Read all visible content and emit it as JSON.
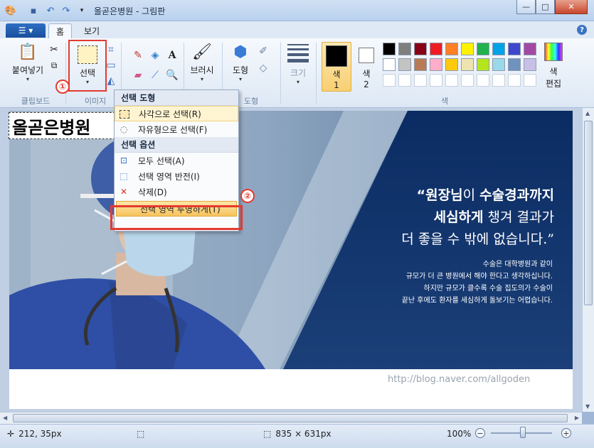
{
  "window": {
    "title": "올곧은병원 - 그림판",
    "minimize": "—",
    "maximize": "□",
    "close": "✕"
  },
  "tabs": [
    {
      "label": "홈",
      "active": true
    },
    {
      "label": "보기",
      "active": false
    }
  ],
  "help_label": "?",
  "ribbon": {
    "clipboard": {
      "paste_label": "붙여넣기",
      "group_label": "클립보드"
    },
    "image": {
      "select_label": "선택",
      "group_label": "이미지"
    },
    "tools_group_label": "도구",
    "brush_label": "브러시",
    "shapes": {
      "label": "도형",
      "group_label": "도형"
    },
    "size_label": "크기",
    "color1_label": "색\n1",
    "color1_line1": "색",
    "color1_line2": "1",
    "color2_line1": "색",
    "color2_line2": "2",
    "edit_colors_line1": "색",
    "edit_colors_line2": "편집",
    "colors_group_label": "색",
    "color1": "#000000",
    "color2": "#ffffff",
    "palette_row1": [
      "#000000",
      "#7f7f7f",
      "#880015",
      "#ed1c24",
      "#ff7f27",
      "#fff200",
      "#22b14c",
      "#00a2e8",
      "#3f48cc",
      "#a349a4"
    ],
    "palette_row2": [
      "#ffffff",
      "#c3c3c3",
      "#b97a57",
      "#ffaec9",
      "#ffc90e",
      "#efe4b0",
      "#b5e61d",
      "#99d9ea",
      "#7092be",
      "#c8bfe7"
    ]
  },
  "markers": {
    "one": "①",
    "two": "②"
  },
  "menu": {
    "section1": "선택 도형",
    "rect_select": "사각으로 선택(R)",
    "free_select": "자유형으로 선택(F)",
    "section2": "선택 옵션",
    "select_all": "모두 선택(A)",
    "invert_selection": "선택 영역 반전(I)",
    "delete": "삭제(D)",
    "transparent_selection": "선택 영역 투명하게(T)"
  },
  "canvas": {
    "selection_text": "올곧은병원",
    "quote_line1_bold1": "“원장님",
    "quote_line1_mid": "이 ",
    "quote_line1_bold2": "수술경과까지",
    "quote_line2_bold": "세심하게",
    "quote_line2_rest": " 챙겨 결과가",
    "quote_line3": "더 좋을 수 밖에 없습니다.”",
    "body_line1": "수술은 대학병원과 같이",
    "body_line2": "규모가 더 큰 병원에서 해야 한다고 생각하십니다.",
    "body_line3": "하지만 규모가 클수록 수술 집도의가 수술이",
    "body_line4": "끝난 후에도 환자를 세심하게 돌보기는 어렵습니다.",
    "watermark": "http://blog.naver.com/allgoden"
  },
  "status": {
    "cursor_pos": "212, 35px",
    "image_size": "835 × 631px",
    "zoom": "100%",
    "zoom_out": "−",
    "zoom_in": "+"
  }
}
